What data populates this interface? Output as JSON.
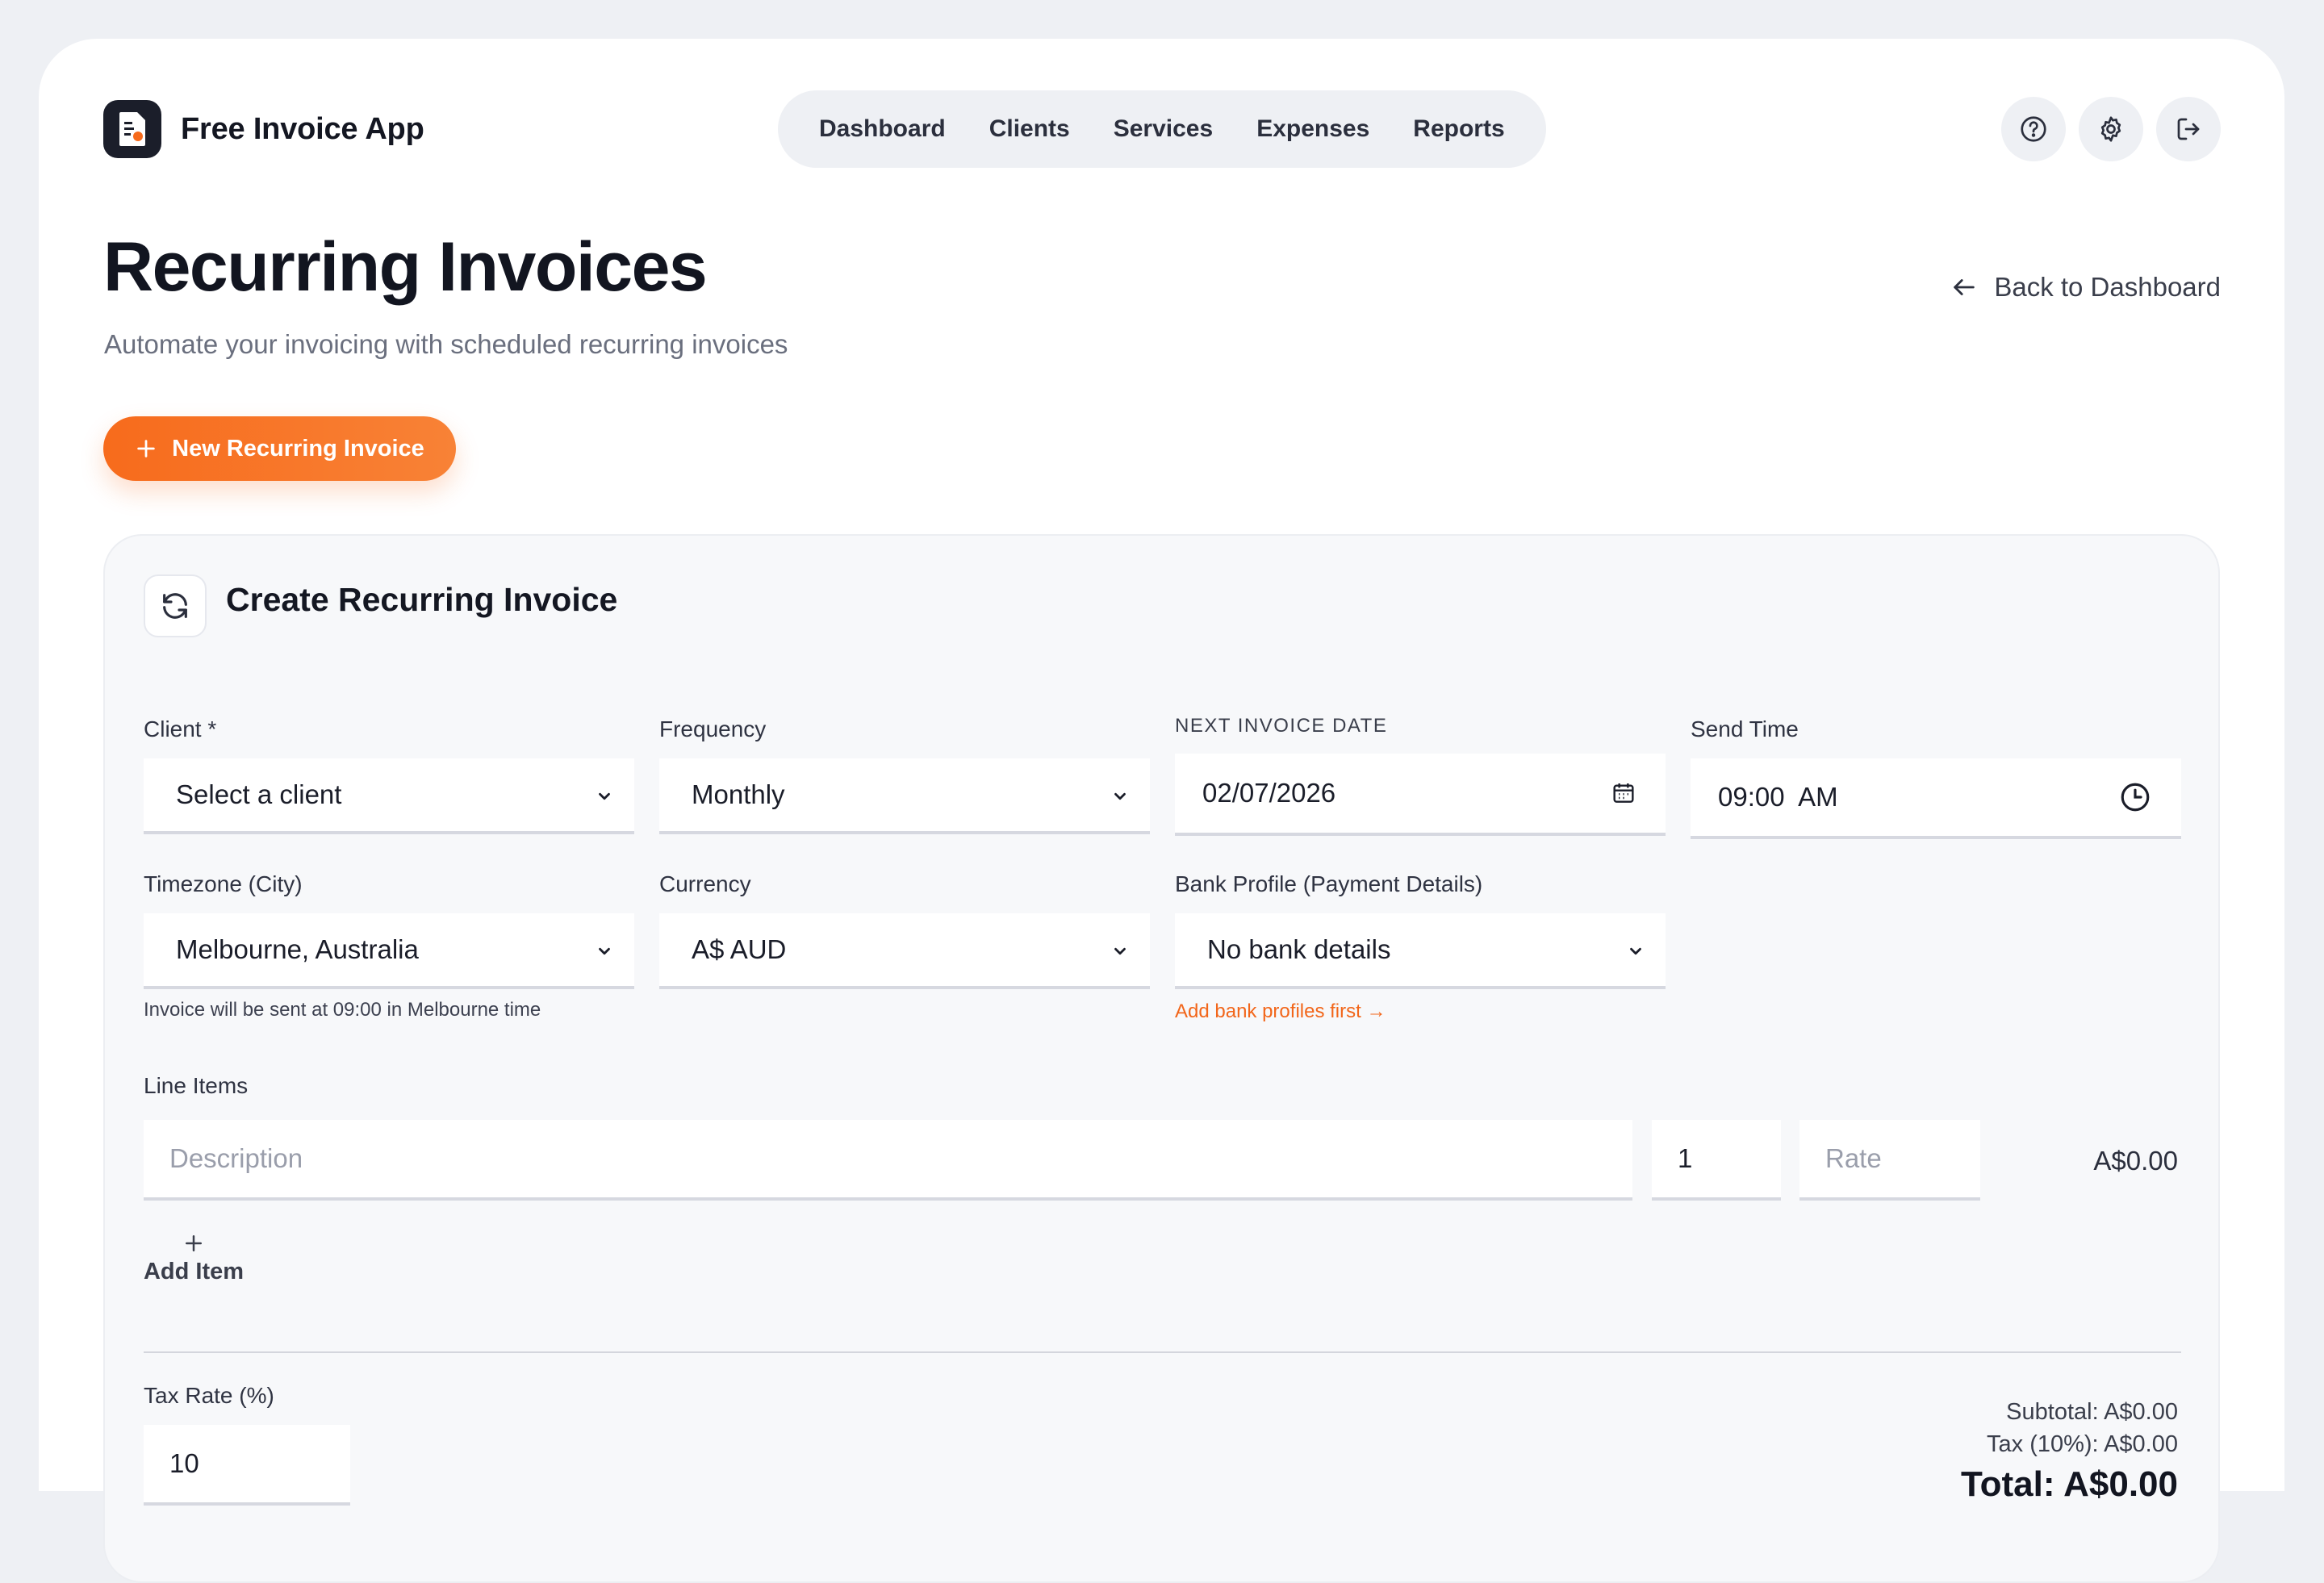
{
  "app": {
    "name": "Free Invoice App"
  },
  "nav": {
    "items": [
      {
        "label": "Dashboard"
      },
      {
        "label": "Clients"
      },
      {
        "label": "Services"
      },
      {
        "label": "Expenses"
      },
      {
        "label": "Reports"
      }
    ]
  },
  "header_icons": [
    "help-icon",
    "settings-icon",
    "logout-icon"
  ],
  "page": {
    "title": "Recurring Invoices",
    "subtitle": "Automate your invoicing with scheduled recurring invoices",
    "back_label": "Back to Dashboard",
    "new_button_label": "New Recurring Invoice"
  },
  "form": {
    "title": "Create Recurring Invoice",
    "client": {
      "label": "Client *",
      "value": "Select a client"
    },
    "frequency": {
      "label": "Frequency",
      "value": "Monthly"
    },
    "next_date": {
      "label": "NEXT INVOICE DATE",
      "value": "02/07/2026"
    },
    "send_time": {
      "label": "Send Time",
      "value": "09:00  AM"
    },
    "timezone": {
      "label": "Timezone (City)",
      "value": "Melbourne, Australia",
      "helper": "Invoice will be sent at 09:00 in Melbourne time"
    },
    "currency": {
      "label": "Currency",
      "value": "A$ AUD"
    },
    "bank_profile": {
      "label": "Bank Profile (Payment Details)",
      "value": "No bank details",
      "helper_link": "Add bank profiles first →"
    },
    "line_items": {
      "label": "Line Items",
      "description_placeholder": "Description",
      "quantity": "1",
      "rate_placeholder": "Rate",
      "amount": "A$0.00",
      "add_label": "Add Item"
    },
    "tax": {
      "label": "Tax Rate (%)",
      "value": "10"
    },
    "totals": {
      "subtotal": "Subtotal: A$0.00",
      "tax": "Tax (10%): A$0.00",
      "total": "Total: A$0.00"
    }
  },
  "colors": {
    "accent": "#f76b1c",
    "dark": "#1b1e2a"
  }
}
